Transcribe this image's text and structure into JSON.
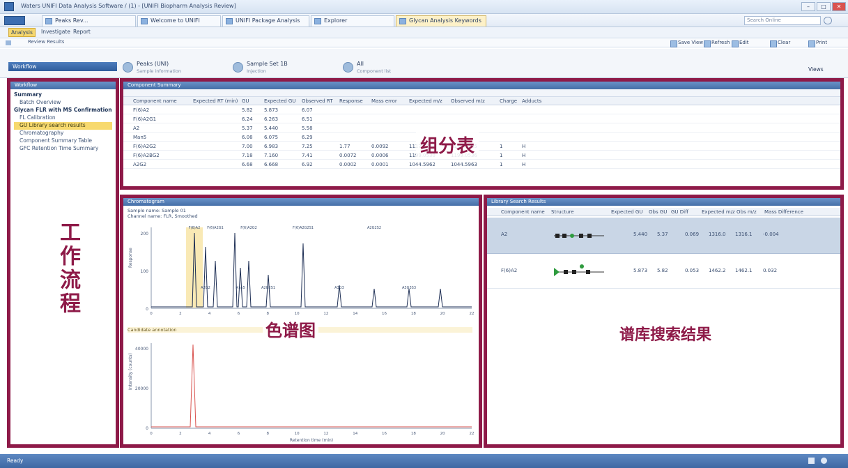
{
  "window": {
    "title": "Waters UNIFI Data Analysis Software / (1) - [UNIFI Biopharm Analysis Review]",
    "controls": [
      "–",
      "□",
      "✕"
    ]
  },
  "tabs": [
    {
      "label": "Peaks Rev..."
    },
    {
      "label": "Welcome to UNIFI"
    },
    {
      "label": "UNIFI Package Analysis"
    },
    {
      "label": "Explorer"
    },
    {
      "label": "Glycan Analysis Keywords"
    }
  ],
  "search": {
    "placeholder": "Search Online"
  },
  "ribbon": {
    "tabs": [
      "Analysis",
      "Investigate",
      "Report"
    ]
  },
  "path": {
    "text": "Review Results"
  },
  "toolbar": {
    "items": [
      "Save View",
      "Refresh",
      "Edit",
      "Clear",
      "Print"
    ]
  },
  "nav": {
    "dropdown": "Workflow",
    "items": [
      {
        "label": "Peaks (UNI)",
        "sub": "Sample information"
      },
      {
        "label": "Sample Set 1B",
        "sub": "Injection"
      },
      {
        "label": "All",
        "sub": "Component list"
      }
    ],
    "right": "Views"
  },
  "workflow": {
    "title": "Workflow",
    "items": [
      {
        "label": "Summary",
        "kind": "h"
      },
      {
        "label": "Batch Overview",
        "kind": "i"
      },
      {
        "label": "Glycan FLR with MS Confirmation",
        "kind": "h"
      },
      {
        "label": "FL Calibration",
        "kind": "i"
      },
      {
        "label": "GU Library search results",
        "kind": "sel"
      },
      {
        "label": "Chromatography",
        "kind": "i"
      },
      {
        "label": "Component Summary Table",
        "kind": "i"
      },
      {
        "label": "GFC Retention Time Summary",
        "kind": "i"
      }
    ]
  },
  "components": {
    "title": "Component Summary",
    "columns": [
      "Component name",
      "Expected RT (min)",
      "GU",
      "Expected GU",
      "Observed RT",
      "Response",
      "Mass error",
      "Expected m/z",
      "Observed m/z",
      "Charge",
      "Adducts"
    ],
    "rows": [
      [
        "F(6)A2",
        "",
        "5.82",
        "5.873",
        "6.07",
        "",
        "",
        "",
        "",
        "",
        ""
      ],
      [
        "F(6)A2G1",
        "",
        "6.24",
        "6.263",
        "6.51",
        "",
        "",
        "",
        "",
        "",
        ""
      ],
      [
        "A2",
        "",
        "5.37",
        "5.440",
        "5.58",
        "",
        "",
        "",
        "",
        "",
        ""
      ],
      [
        "Man5",
        "",
        "6.08",
        "6.075",
        "6.29",
        "",
        "",
        "",
        "",
        "",
        ""
      ],
      [
        "F(6)A2G2",
        "",
        "7.00",
        "6.983",
        "7.25",
        "1.77",
        "0.0092",
        "1117.6213",
        "1117.6305",
        "1",
        "H"
      ],
      [
        "F(6)A2BG2",
        "",
        "7.18",
        "7.160",
        "7.41",
        "0.0072",
        "0.0006",
        "1199.0530",
        "1199.0536",
        "1",
        "H"
      ],
      [
        "A2G2",
        "",
        "6.68",
        "6.668",
        "6.92",
        "0.0002",
        "0.0001",
        "1044.5962",
        "1044.5963",
        "1",
        "H"
      ]
    ]
  },
  "chromatogram": {
    "title": "Chromatogram",
    "sample": "Sample name: Sample 01",
    "subtitle": "Channel name: FLR, Smoothed",
    "yticks_top": [
      "200",
      "100",
      "0"
    ],
    "yticks_bottom": [
      "40000",
      "20000",
      "0"
    ],
    "xticks": [
      "0",
      "2",
      "4",
      "6",
      "8",
      "10",
      "12",
      "14",
      "16",
      "18",
      "20",
      "22"
    ],
    "xlabel": "Retention time (min)",
    "ylabel_top": "Response",
    "ylabel_bottom": "Intensity (counts)",
    "peak_labels": [
      "F(6)A2",
      "A2G2",
      "F(6)A2G1",
      "Man5",
      "F(6)A2G2",
      "A2G2S1",
      "F(6)A2G2S1",
      "A3G3",
      "A2G2S2",
      "A3G3S3"
    ],
    "caption": "Candidate annotation"
  },
  "library": {
    "title": "Library Search Results",
    "columns": [
      "Component name",
      "Structure",
      "Expected GU",
      "Obs GU",
      "GU Diff",
      "Expected m/z",
      "Obs m/z",
      "Mass Difference"
    ],
    "rows": [
      [
        "A2",
        "",
        "5.440",
        "5.37",
        "0.069",
        "1316.0",
        "1316.1",
        "-0.004"
      ],
      [
        "F(6)A2",
        "",
        "5.873",
        "5.82",
        "0.053",
        "1462.2",
        "1462.1",
        "0.032"
      ]
    ]
  },
  "overlays": {
    "workflow": "工作流程",
    "table": "组分表",
    "chromatogram": "色谱图",
    "library": "谱库搜索结果"
  },
  "statusbar": {
    "text": "Ready",
    "icons": [
      "arrow-icon",
      "refresh-icon"
    ]
  },
  "colors": {
    "frame": "#8e1a48",
    "header": "#4a74ad",
    "highlight": "#f7d96e"
  }
}
